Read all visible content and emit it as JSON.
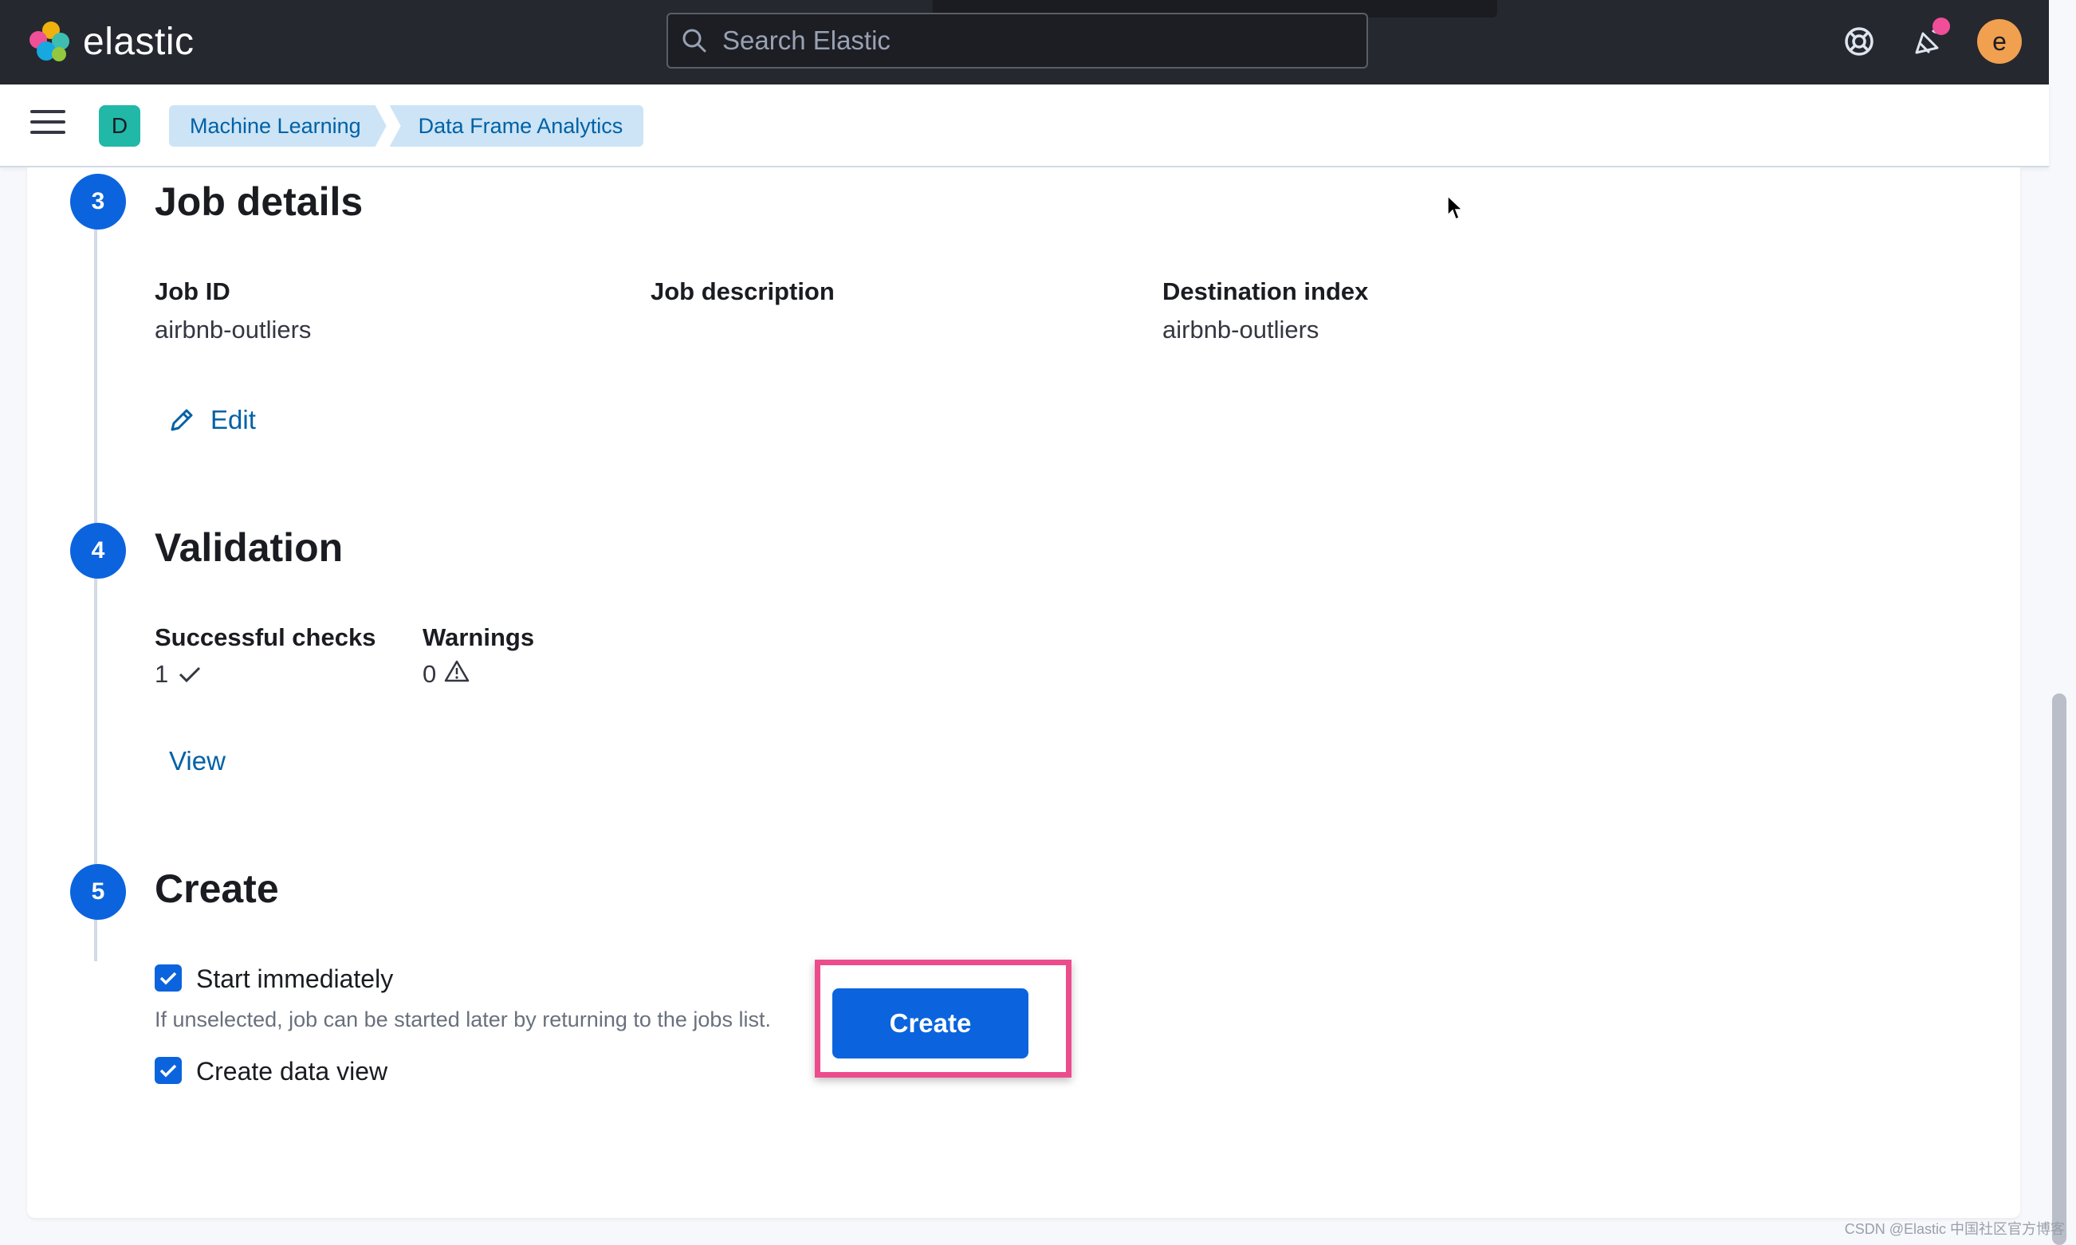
{
  "header": {
    "brand": "elastic",
    "search_placeholder": "Search Elastic",
    "avatar_letter": "e"
  },
  "subheader": {
    "space_letter": "D",
    "breadcrumbs": [
      "Machine Learning",
      "Data Frame Analytics"
    ]
  },
  "steps": {
    "job_details": {
      "number": "3",
      "title": "Job details",
      "job_id_label": "Job ID",
      "job_id_value": "airbnb-outliers",
      "job_description_label": "Job description",
      "destination_index_label": "Destination index",
      "destination_index_value": "airbnb-outliers",
      "edit_label": "Edit"
    },
    "validation": {
      "number": "4",
      "title": "Validation",
      "successful_checks_label": "Successful checks",
      "successful_checks_value": "1",
      "warnings_label": "Warnings",
      "warnings_value": "0",
      "view_label": "View"
    },
    "create": {
      "number": "5",
      "title": "Create",
      "start_immediately_label": "Start immediately",
      "start_immediately_help": "If unselected, job can be started later by returning to the jobs list.",
      "create_data_view_label": "Create data view",
      "create_button_label": "Create"
    }
  },
  "watermark": "CSDN @Elastic 中国社区官方博客",
  "colors": {
    "header_bg": "#25282f",
    "primary": "#0b64dd",
    "link": "#0061a6",
    "highlight": "#ec4c8c",
    "avatar": "#f1a050",
    "space_badge": "#21b8a8"
  }
}
